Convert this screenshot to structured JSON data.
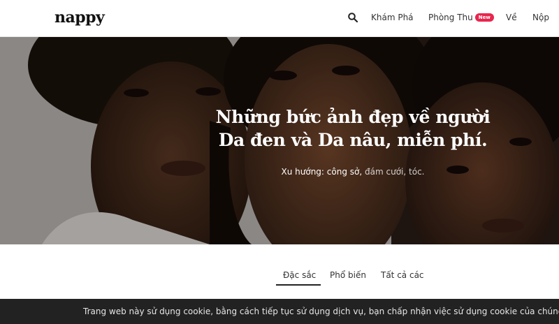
{
  "header": {
    "logo": "nappy",
    "nav": {
      "search_icon": "search-icon",
      "explore": "Khám Phá",
      "studio": "Phòng Thu",
      "studio_badge": "New",
      "about": "Về",
      "submit": "Nộp"
    }
  },
  "hero": {
    "title_line1": "Những bức ảnh đẹp về người",
    "title_line2": "Da đen và Da nâu, miễn phí.",
    "trending_label": "Xu hướng:",
    "trending_tags": [
      "công sở,",
      "đám cưới,",
      "tóc."
    ]
  },
  "tabs": {
    "featured": "Đặc sắc",
    "popular": "Phổ biến",
    "all": "Tất cả các",
    "active": "featured"
  },
  "cookie": {
    "text": "Trang web này sử dụng cookie, bằng cách tiếp tục sử dụng dịch vụ, bạn chấp nhận việc sử dụng cookie của chúng tôi."
  },
  "colors": {
    "badge": "#e8264e",
    "cookie_bar": "#222222"
  }
}
